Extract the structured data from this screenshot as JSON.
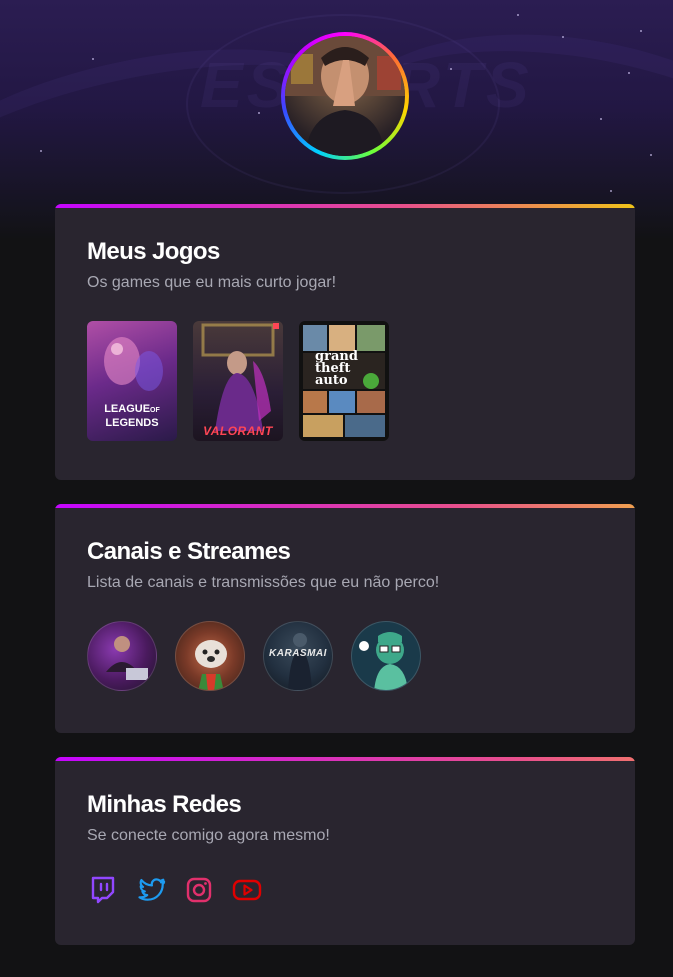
{
  "hero": {
    "background_logo": "ESPORTS",
    "avatar_alt": "profile-photo"
  },
  "gradient": {
    "start": "#c505ff",
    "middle": "#e8508c",
    "end": "#f0c419"
  },
  "games_card": {
    "title": "Meus Jogos",
    "subtitle": "Os games que eu mais curto jogar!",
    "games": [
      {
        "label": "LEAGUE OF LEGENDS",
        "line1": "LEAGUE",
        "line1b": "OF",
        "line2": "LEGENDS",
        "color": "#6b2a8a"
      },
      {
        "label": "VALORANT",
        "color": "#2a1e36",
        "accent": "#ff4655"
      },
      {
        "label": "Grand Theft Auto V",
        "line1": "grand",
        "line2": "theft",
        "line3": "auto",
        "color": "#d7c29c"
      }
    ]
  },
  "channels_card": {
    "title": "Canais e Streames",
    "subtitle": "Lista de canais e transmissões que eu não perco!",
    "channels": [
      {
        "name": "streamer-1",
        "color": "#5a1c6e"
      },
      {
        "name": "streamer-2",
        "color": "#7a3a28"
      },
      {
        "name": "KARASMAI",
        "label": "KARASMAI",
        "color": "#223040"
      },
      {
        "name": "streamer-4",
        "color": "#3ea88a"
      }
    ]
  },
  "social_card": {
    "title": "Minhas Redes",
    "subtitle": "Se conecte comigo agora mesmo!",
    "icons": [
      {
        "icon": "twitch-icon",
        "color": "#9147ff"
      },
      {
        "icon": "twitter-icon",
        "color": "#1d9bf0"
      },
      {
        "icon": "instagram-icon",
        "color": "#e1306c"
      },
      {
        "icon": "youtube-icon",
        "color": "#ff0000"
      }
    ]
  }
}
